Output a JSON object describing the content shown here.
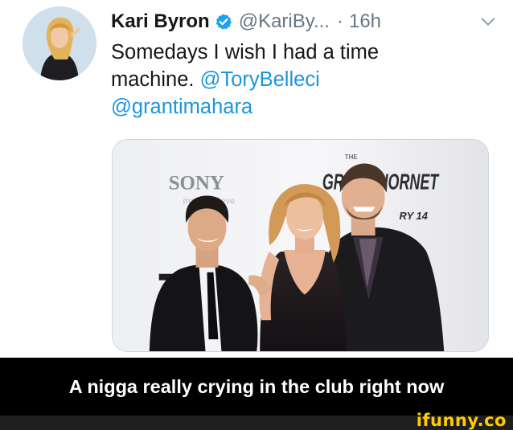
{
  "tweet": {
    "author_name": "Kari Byron",
    "handle": "@KariBy...",
    "separator": "·",
    "time": "16h",
    "text_lines": [
      {
        "plain": "Somedays I wish I had a time",
        "mention": ""
      },
      {
        "plain": "machine. ",
        "mention": "@ToryBelleci"
      },
      {
        "plain": "",
        "mention": "@grantimahara"
      }
    ],
    "media": {
      "backdrop_sony": "SONY",
      "backdrop_sony_tagline": "make.believe",
      "backdrop_title": "GREEN HORNET",
      "backdrop_title_small": "THE",
      "backdrop_date": "RY 14"
    }
  },
  "caption": {
    "text": "A nigga really crying in the club right now"
  },
  "watermark": {
    "text": "ifunny.co"
  },
  "colors": {
    "mention": "#1b95e0",
    "verified": "#1da1f2",
    "secondary_text": "#657786",
    "watermark": "#ffcc00"
  },
  "icons": {
    "verified": "verified-badge-icon",
    "menu": "chevron-down-icon"
  }
}
